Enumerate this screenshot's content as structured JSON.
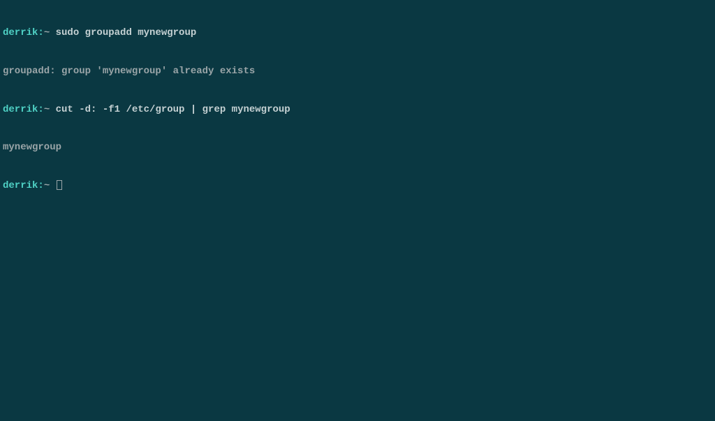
{
  "terminal": {
    "lines": [
      {
        "prompt_user": "derrik:",
        "prompt_tilde": "~ ",
        "command": "sudo groupadd mynewgroup"
      },
      {
        "output": "groupadd: group 'mynewgroup' already exists"
      },
      {
        "prompt_user": "derrik:",
        "prompt_tilde": "~ ",
        "command": "cut -d: -f1 /etc/group | grep mynewgroup"
      },
      {
        "output": "mynewgroup"
      },
      {
        "prompt_user": "derrik:",
        "prompt_tilde": "~ ",
        "command": "",
        "cursor": true
      }
    ]
  }
}
